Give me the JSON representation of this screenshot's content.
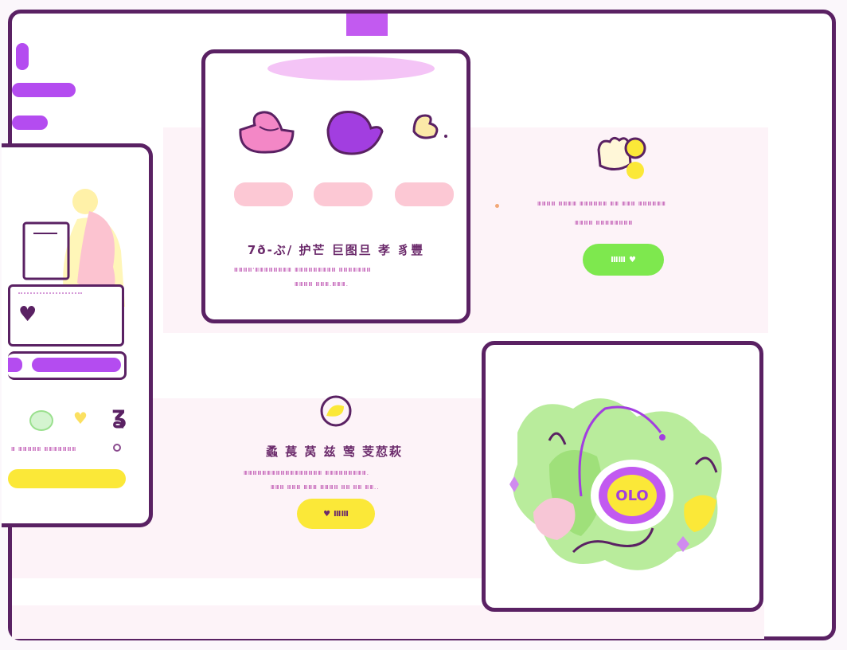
{
  "main_card": {
    "heading": "7ð-ぶ/ 护芒 巨图旦 孝 豸豐",
    "line1": "ⅢⅢⅢⅢ'ⅢⅢⅢⅢⅢⅢⅢⅢ ⅢⅢⅢⅢⅢⅢⅢⅢⅢ ⅢⅢⅢⅢⅢⅢⅢ",
    "line2": "ⅢⅢⅢⅢ ⅢⅢⅢ.ⅢⅢⅢ."
  },
  "right_panel": {
    "line1": "ⅢⅢⅢⅢ ⅢⅢⅢⅢ ⅢⅢⅢⅢⅢⅢ ⅢⅢ ⅢⅢⅢ ⅢⅢⅢⅢⅢⅢ",
    "line2": "ⅢⅢⅢⅢ ⅢⅢⅢⅢⅢⅢⅢⅢ",
    "button_label": "ⅢⅢ"
  },
  "center_panel": {
    "heading": "蟊 萇 莴 兹 莺 芰荵萩",
    "line1": "ⅢⅢⅢⅢⅢⅢⅢⅢⅢⅢⅢⅢⅢⅢⅢⅢⅢ ⅢⅢⅢⅢⅢⅢⅢⅢⅢ.",
    "line2": "ⅢⅢⅢ ⅢⅢⅢ ⅢⅢⅢ ⅢⅢⅢⅢ ⅢⅢ ⅢⅢ ⅢⅢ..",
    "button_label": "ⅢⅢ"
  },
  "left_card": {
    "caption": "Ⅲ ⅢⅢⅢⅢⅢ ⅢⅢⅢⅢⅢⅢⅢ"
  },
  "illustration": {
    "badge_text": "OLO"
  },
  "colors": {
    "frame": "#5a2163",
    "purple": "#b44cf0",
    "green": "#7ee84e",
    "yellow": "#fbe838",
    "pink": "#fcc8d4"
  }
}
